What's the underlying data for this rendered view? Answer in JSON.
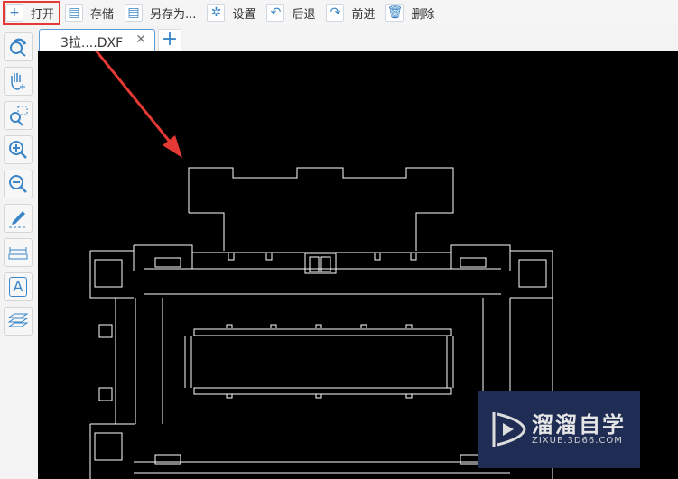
{
  "toolbar": {
    "open": "打开",
    "save": "存储",
    "save_as": "另存为...",
    "settings": "设置",
    "back": "后退",
    "forward": "前进",
    "delete": "删除"
  },
  "tabs": [
    {
      "label": "3拉....DXF",
      "close": "✕"
    }
  ],
  "add_tab": "+",
  "sidebar": [
    "rotate-view",
    "pan",
    "zoom-window",
    "zoom-in",
    "zoom-out",
    "draw",
    "measure",
    "text",
    "layers"
  ],
  "sidebar_text_icon": "A",
  "watermark": {
    "brand": "溜溜自学",
    "url": "ZIXUE.3D66.COM"
  },
  "colors": {
    "accent": "#3a86c8",
    "highlight": "#e53935",
    "canvas": "#000000"
  }
}
